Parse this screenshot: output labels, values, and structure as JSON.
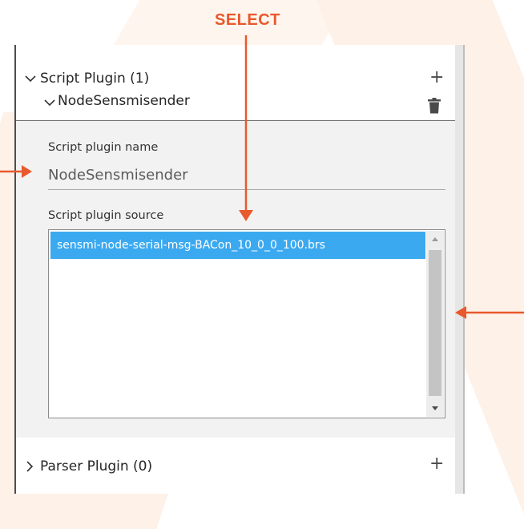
{
  "annotation": {
    "select_label": "SELECT"
  },
  "colors": {
    "accent": "#e8592c",
    "selection": "#3ba9f0"
  },
  "panel": {
    "script_plugin": {
      "header": "Script Plugin (1)",
      "expanded": true,
      "add_icon": "plus-icon",
      "plugin": {
        "name": "NodeSensmisender",
        "delete_icon": "trash-icon",
        "name_label": "Script plugin name",
        "name_value": "NodeSensmisender",
        "source_label": "Script plugin source",
        "sources": [
          "sensmi-node-serial-msg-BACon_10_0_0_100.brs"
        ]
      }
    },
    "parser_plugin": {
      "header": "Parser Plugin (0)",
      "expanded": false,
      "add_icon": "plus-icon"
    }
  }
}
